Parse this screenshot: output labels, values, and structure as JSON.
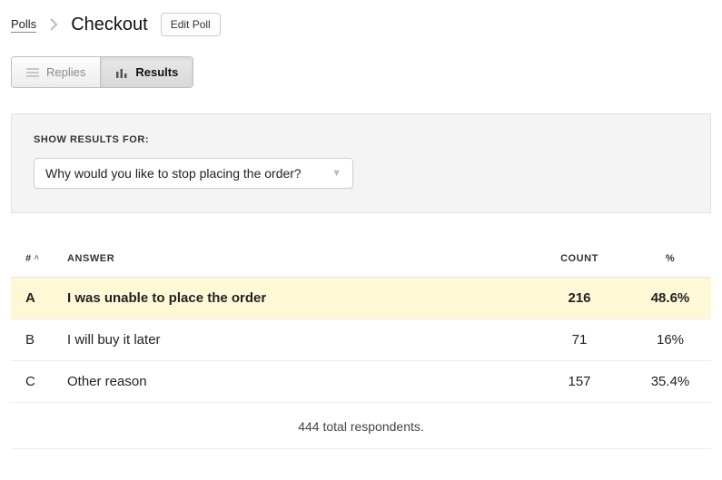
{
  "breadcrumb": {
    "root": "Polls",
    "title": "Checkout",
    "edit_label": "Edit Poll"
  },
  "tabs": {
    "replies": "Replies",
    "results": "Results"
  },
  "filter": {
    "label": "SHOW RESULTS FOR:",
    "selected": "Why would you like to stop placing the order?"
  },
  "table": {
    "headers": {
      "idx": "#",
      "answer": "ANSWER",
      "count": "COUNT",
      "pct": "%"
    },
    "rows": [
      {
        "idx": "A",
        "answer": "I was unable to place the order",
        "count": "216",
        "pct": "48.6%"
      },
      {
        "idx": "B",
        "answer": "I will buy it later",
        "count": "71",
        "pct": "16%"
      },
      {
        "idx": "C",
        "answer": "Other reason",
        "count": "157",
        "pct": "35.4%"
      }
    ],
    "total": "444 total respondents."
  },
  "chart_data": {
    "type": "bar",
    "title": "Why would you like to stop placing the order?",
    "categories": [
      "I was unable to place the order",
      "I will buy it later",
      "Other reason"
    ],
    "series": [
      {
        "name": "Count",
        "values": [
          216,
          71,
          157
        ]
      },
      {
        "name": "Percent",
        "values": [
          48.6,
          16,
          35.4
        ]
      }
    ],
    "total_respondents": 444
  }
}
